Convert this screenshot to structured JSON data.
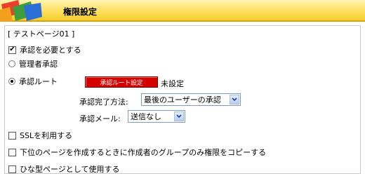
{
  "header": {
    "title": "権限設定"
  },
  "page": {
    "label": "[ テストページ01 ]"
  },
  "options": {
    "require_approval": {
      "label": "承認を必要とする",
      "checked": true
    },
    "admin_approval": {
      "label": "管理者承認",
      "selected": false
    },
    "route_approval": {
      "label": "承認ルート",
      "selected": true
    },
    "use_ssl": {
      "label": "SSLを利用する",
      "checked": false
    },
    "copy_creator_group": {
      "label": "下位のページを作成するときに作成者のグループのみ権限をコピーする",
      "checked": false
    },
    "use_as_template": {
      "label": "ひな型ページとして使用する",
      "checked": false
    }
  },
  "route": {
    "button_label": "承認ルート設定",
    "status": "未設定"
  },
  "completion_method": {
    "label": "承認完了方法:",
    "selected": "最後のユーザーの承認"
  },
  "approval_mail": {
    "label": "承認メール:",
    "selected": "送信なし"
  },
  "colors": {
    "header_gradient_top": "#fff3b3",
    "header_gradient_bottom": "#f5cd2e",
    "button_red": "#d40000"
  }
}
